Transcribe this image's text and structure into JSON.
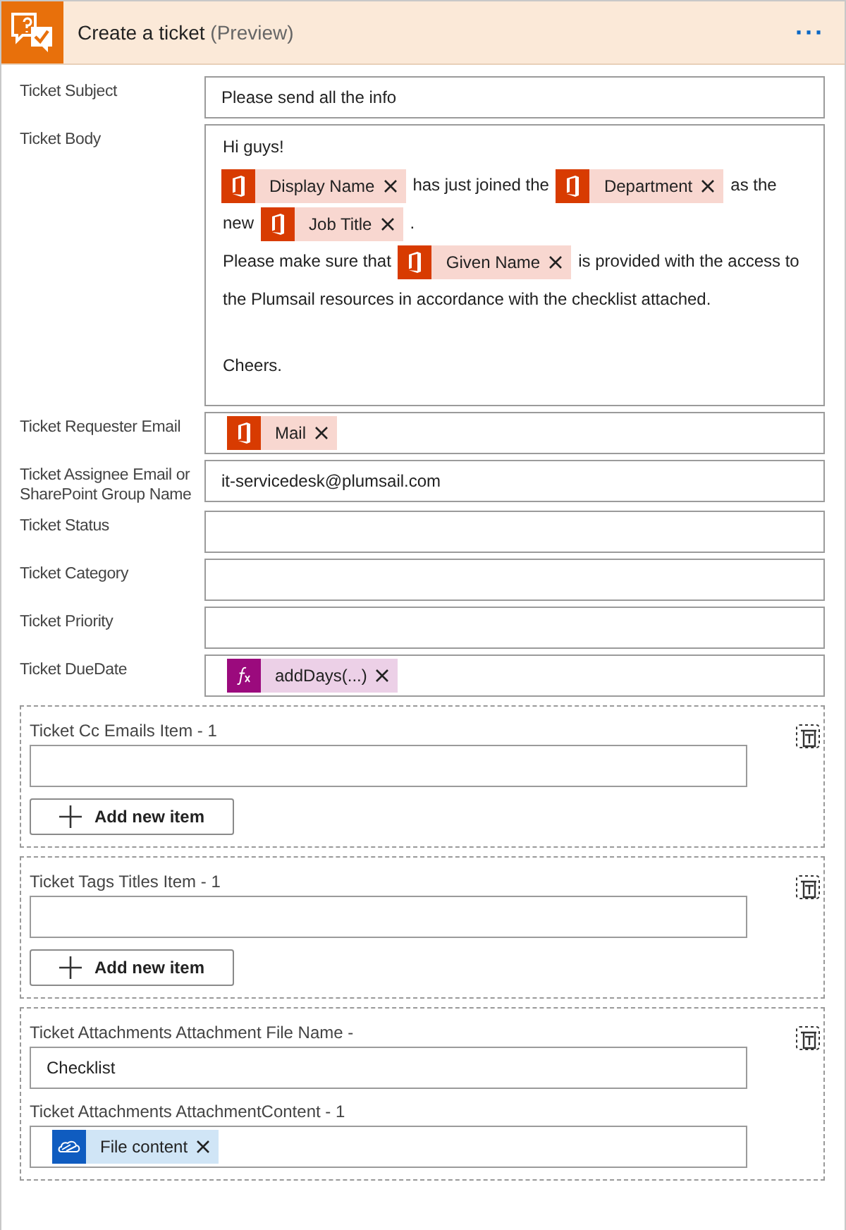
{
  "header": {
    "title": "Create a ticket",
    "suffix": "(Preview)",
    "more": "···"
  },
  "fields": [
    {
      "label": "Ticket Subject",
      "kind": "text",
      "value": "Please send all the info"
    },
    {
      "label": "Ticket Body",
      "kind": "rich",
      "lines": [
        [
          {
            "kind": "text",
            "text": "Hi guys!"
          }
        ],
        [
          {
            "kind": "office",
            "label": "Display Name"
          },
          {
            "kind": "text",
            "text": "has just joined the"
          },
          {
            "kind": "office",
            "label": "Department"
          },
          {
            "kind": "text",
            "text": "as the"
          }
        ],
        [
          {
            "kind": "text",
            "text": "new"
          },
          {
            "kind": "office",
            "label": "Job Title"
          },
          {
            "kind": "text",
            "text": "."
          }
        ],
        [
          {
            "kind": "text",
            "text": "Please make sure that"
          },
          {
            "kind": "office",
            "label": "Given Name"
          },
          {
            "kind": "text",
            "text": "is provided with the access to"
          }
        ],
        [
          {
            "kind": "text",
            "text": "the Plumsail resources in accordance with the checklist attached."
          }
        ],
        [
          {
            "kind": "text",
            "text": "Cheers."
          }
        ]
      ]
    },
    {
      "label": "Ticket Requester Email",
      "kind": "tokens",
      "tokens": [
        {
          "kind": "office",
          "label": "Mail"
        }
      ]
    },
    {
      "label": "Ticket Assignee Email or SharePoint Group Name",
      "kind": "text",
      "value": "it-servicedesk@plumsail.com"
    },
    {
      "label": "Ticket Status",
      "kind": "text"
    },
    {
      "label": "Ticket Category",
      "kind": "text"
    },
    {
      "label": "Ticket Priority",
      "kind": "text"
    },
    {
      "label": "Ticket DueDate",
      "kind": "tokens",
      "tokens": [
        {
          "kind": "expression",
          "label": "addDays(...)"
        }
      ]
    }
  ],
  "arrays": [
    {
      "items": [
        {
          "label": "Ticket Cc Emails Item - 1",
          "kind": "text"
        }
      ],
      "add_button": "Add new item"
    },
    {
      "items": [
        {
          "label": "Ticket Tags Titles Item - 1",
          "kind": "text"
        }
      ],
      "add_button": "Add new item"
    },
    {
      "items": [
        {
          "label": "Ticket Attachments Attachment File Name -",
          "kind": "text",
          "value": "Checklist"
        },
        {
          "label": "Ticket Attachments AttachmentContent - 1",
          "kind": "tokens",
          "tokens": [
            {
              "kind": "onedrive",
              "label": "File content"
            }
          ]
        }
      ]
    }
  ]
}
